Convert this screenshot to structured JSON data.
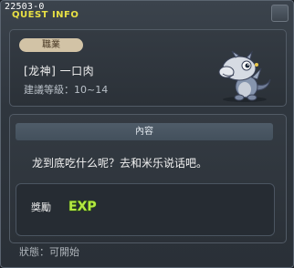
{
  "window": {
    "id": "22503-0",
    "title": "QUEST INFO"
  },
  "quest": {
    "job_badge": "職業",
    "name": "[龙神]   一口肉",
    "level": "建議等級：10~14"
  },
  "content": {
    "header": "內容",
    "text": "龙到底吃什么呢？去和米乐说话吧。"
  },
  "reward": {
    "label": "獎勵",
    "badge": "EXP"
  },
  "status": {
    "text": "狀態：可開始"
  },
  "colors": {
    "title": "#e8e044",
    "exp": "#b4e842",
    "badge_bg": "#d2c3a6"
  }
}
